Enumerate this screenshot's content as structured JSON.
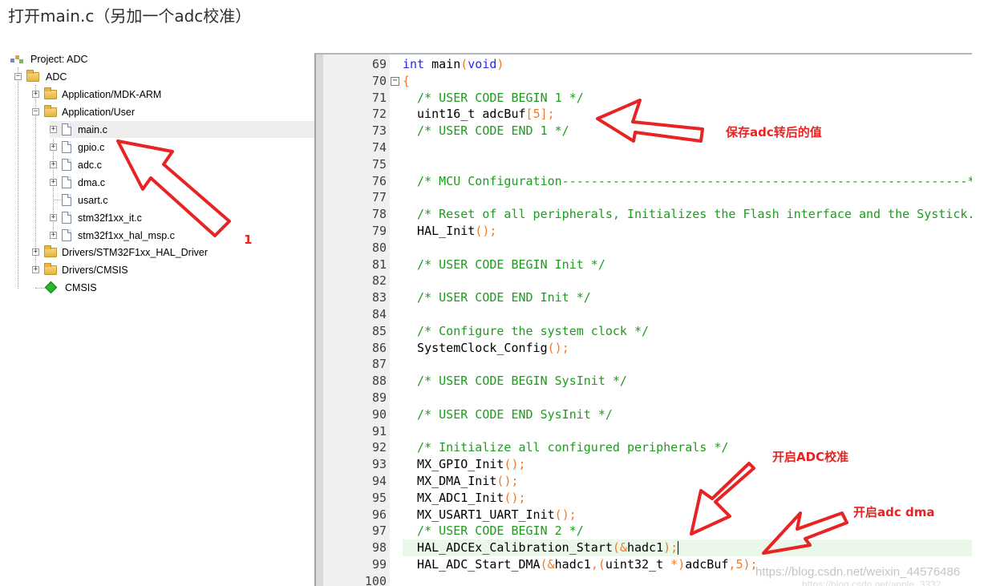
{
  "heading": "打开main.c（另加一个adc校准）",
  "tree": {
    "project": "Project: ADC",
    "target": "ADC",
    "groups": [
      {
        "label": "Application/MDK-ARM"
      },
      {
        "label": "Application/User"
      },
      {
        "label": "Drivers/STM32F1xx_HAL_Driver"
      },
      {
        "label": "Drivers/CMSIS"
      }
    ],
    "files": [
      {
        "label": "main.c"
      },
      {
        "label": "gpio.c"
      },
      {
        "label": "adc.c"
      },
      {
        "label": "dma.c"
      },
      {
        "label": "usart.c"
      },
      {
        "label": "stm32f1xx_it.c"
      },
      {
        "label": "stm32f1xx_hal_msp.c"
      }
    ],
    "cmsis": "CMSIS"
  },
  "editor": {
    "lines": [
      {
        "no": "69",
        "text": "int main(void)"
      },
      {
        "no": "70",
        "text": "{"
      },
      {
        "no": "71",
        "text": "  /* USER CODE BEGIN 1 */"
      },
      {
        "no": "72",
        "text": "  uint16_t adcBuf[5];"
      },
      {
        "no": "73",
        "text": "  /* USER CODE END 1 */"
      },
      {
        "no": "74",
        "text": ""
      },
      {
        "no": "75",
        "text": ""
      },
      {
        "no": "76",
        "text": "  /* MCU Configuration--------------------------------------------------------*/"
      },
      {
        "no": "77",
        "text": ""
      },
      {
        "no": "78",
        "text": "  /* Reset of all peripherals, Initializes the Flash interface and the Systick. */"
      },
      {
        "no": "79",
        "text": "  HAL_Init();"
      },
      {
        "no": "80",
        "text": ""
      },
      {
        "no": "81",
        "text": "  /* USER CODE BEGIN Init */"
      },
      {
        "no": "82",
        "text": ""
      },
      {
        "no": "83",
        "text": "  /* USER CODE END Init */"
      },
      {
        "no": "84",
        "text": ""
      },
      {
        "no": "85",
        "text": "  /* Configure the system clock */"
      },
      {
        "no": "86",
        "text": "  SystemClock_Config();"
      },
      {
        "no": "87",
        "text": ""
      },
      {
        "no": "88",
        "text": "  /* USER CODE BEGIN SysInit */"
      },
      {
        "no": "89",
        "text": ""
      },
      {
        "no": "90",
        "text": "  /* USER CODE END SysInit */"
      },
      {
        "no": "91",
        "text": ""
      },
      {
        "no": "92",
        "text": "  /* Initialize all configured peripherals */"
      },
      {
        "no": "93",
        "text": "  MX_GPIO_Init();"
      },
      {
        "no": "94",
        "text": "  MX_DMA_Init();"
      },
      {
        "no": "95",
        "text": "  MX_ADC1_Init();"
      },
      {
        "no": "96",
        "text": "  MX_USART1_UART_Init();"
      },
      {
        "no": "97",
        "text": "  /* USER CODE BEGIN 2 */"
      },
      {
        "no": "98",
        "text": "  HAL_ADCEx_Calibration_Start(&hadc1);"
      },
      {
        "no": "99",
        "text": "  HAL_ADC_Start_DMA(&hadc1,(uint32_t *)adcBuf,5);"
      },
      {
        "no": "100",
        "text": ""
      }
    ]
  },
  "annotations": {
    "label_1": "1",
    "label_save": "保存adc转后的值",
    "label_calib": "开启ADC校准",
    "label_dma": "开启adc dma",
    "arrow_color": "#e82323"
  },
  "watermark": "https://blog.csdn.net/weixin_44576486",
  "watermark2": "https://blog.csdn.net/apple_3332"
}
